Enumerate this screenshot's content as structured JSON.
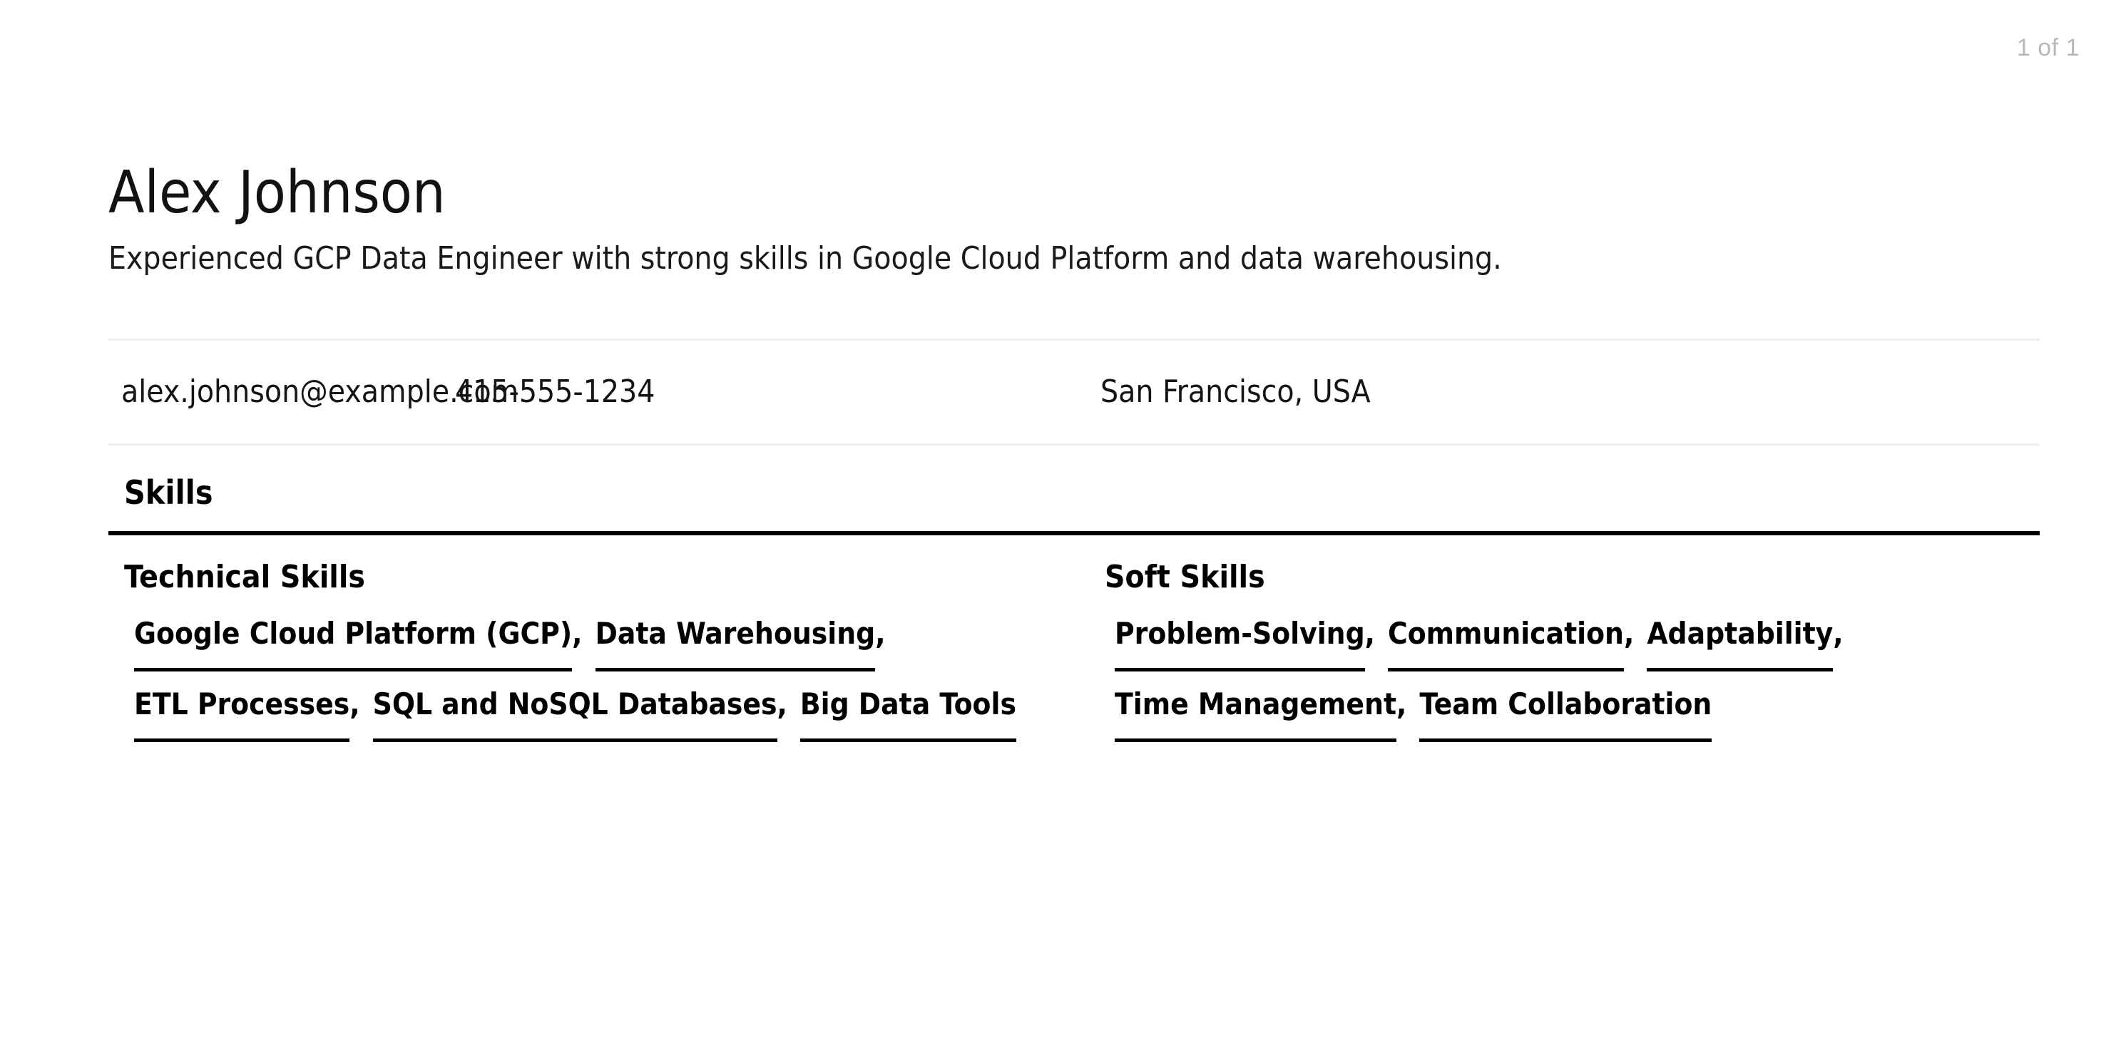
{
  "viewer": {
    "page_indicator": "1 of 1"
  },
  "resume": {
    "name": "Alex Johnson",
    "tagline": "Experienced GCP Data Engineer with strong skills in Google Cloud Platform and data warehousing.",
    "contact": {
      "email": "alex.johnson@example.com",
      "phone": "415-555-1234",
      "location": "San Francisco, USA"
    },
    "section": {
      "title": "Skills",
      "columns": [
        {
          "title": "Technical Skills",
          "items": [
            {
              "label": "Google Cloud Platform (GCP)",
              "sep": ","
            },
            {
              "label": "Data Warehousing",
              "sep": ","
            },
            {
              "label": "ETL Processes",
              "sep": ","
            },
            {
              "label": "SQL and NoSQL Databases",
              "sep": ","
            },
            {
              "label": "Big Data Tools",
              "sep": ""
            }
          ]
        },
        {
          "title": "Soft Skills",
          "items": [
            {
              "label": "Problem-Solving",
              "sep": ","
            },
            {
              "label": "Communication",
              "sep": ","
            },
            {
              "label": "Adaptability",
              "sep": ","
            },
            {
              "label": "Time Management",
              "sep": ","
            },
            {
              "label": "Team Collaboration",
              "sep": ""
            }
          ]
        }
      ]
    }
  },
  "colors": {
    "text": "#111111",
    "rule_light": "#eeeeee",
    "rule_heavy": "#000000",
    "page_indicator": "#b8b8b8",
    "background": "#ffffff"
  }
}
